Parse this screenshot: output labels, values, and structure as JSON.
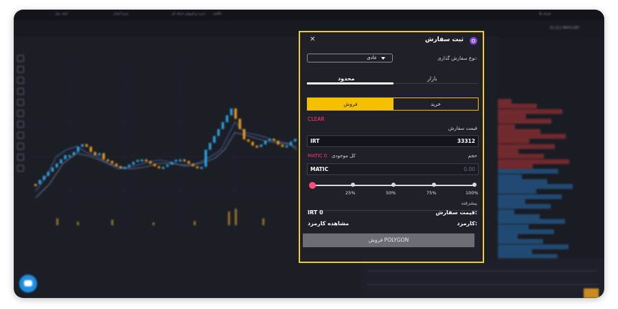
{
  "header": {
    "nav": [
      "تعرفه ها",
      "خرید و فروش حرفه ای",
      "خرید آسان",
      "کیف پول",
      "خلاصه"
    ],
    "price_pair": "33,312 MATIC/IRT"
  },
  "modal": {
    "title": "ثبت سفارش",
    "order_type_label": "نوع سفارش گذاری:",
    "order_type_value": "عادی",
    "tabs": {
      "market": "بازار",
      "limit": "محدود"
    },
    "side": {
      "sell": "فروش",
      "buy": "خرید"
    },
    "clear_label": "CLEAR",
    "price_label": "قیمت سفارش",
    "price_value": "33312",
    "price_unit": "IRT",
    "volume_label": "حجم",
    "balance_label": "کل موجودی",
    "balance_value": "MATIC 0",
    "volume_unit": "MATIC",
    "volume_value": "0.00",
    "percentages": [
      "100%",
      "75%",
      "50%",
      "25%"
    ],
    "advanced_label": "پیشرفته",
    "order_price_label": "قیمت سفارش:",
    "order_price_value": "IRT 0",
    "fee_label": "کارمزد:",
    "fee_value": "مشاهده کارمزد",
    "submit_label": "فروش POLYGON"
  },
  "colors": {
    "accent": "#f5c000",
    "highlight_border": "#f2d21a",
    "clear": "#ff3a74",
    "submit": "#6c6e74"
  }
}
